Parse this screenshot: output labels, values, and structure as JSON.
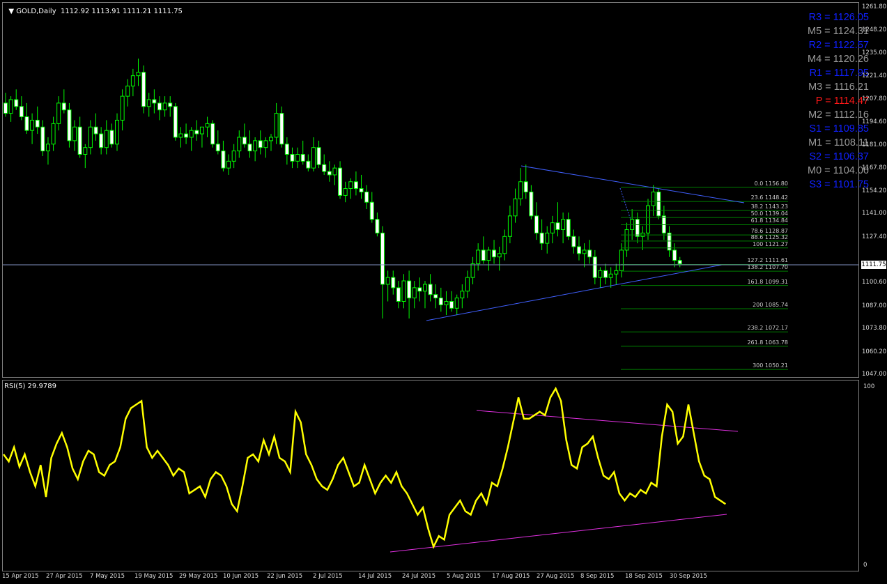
{
  "header": {
    "symbol": "GOLD,Daily",
    "ohlc": "1112.92 1113.91 1111.21 1111.75",
    "rsi_label": "RSI(5) 29.9789"
  },
  "pivots": [
    {
      "name": "R3",
      "value": "1126.05",
      "color": "#1020ff"
    },
    {
      "name": "M5",
      "value": "1124.31",
      "color": "#9a9a9a"
    },
    {
      "name": "R2",
      "value": "1122.57",
      "color": "#1020ff"
    },
    {
      "name": "M4",
      "value": "1120.26",
      "color": "#9a9a9a"
    },
    {
      "name": "R1",
      "value": "1117.95",
      "color": "#1020ff"
    },
    {
      "name": "M3",
      "value": "1116.21",
      "color": "#9a9a9a"
    },
    {
      "name": "P",
      "value": "1114.47",
      "color": "#ff1818"
    },
    {
      "name": "M2",
      "value": "1112.16",
      "color": "#9a9a9a"
    },
    {
      "name": "S1",
      "value": "1109.85",
      "color": "#1020ff"
    },
    {
      "name": "M1",
      "value": "1108.11",
      "color": "#9a9a9a"
    },
    {
      "name": "S2",
      "value": "1106.37",
      "color": "#1020ff"
    },
    {
      "name": "M0",
      "value": "1104.06",
      "color": "#9a9a9a"
    },
    {
      "name": "S3",
      "value": "1101.75",
      "color": "#1020ff"
    }
  ],
  "fibonacci": [
    {
      "label": "0.0 1156.80",
      "price": 1156.8
    },
    {
      "label": "23.6 1148.42",
      "price": 1148.42
    },
    {
      "label": "38.2 1143.23",
      "price": 1143.23
    },
    {
      "label": "50.0 1139.04",
      "price": 1139.04
    },
    {
      "label": "61.8 1134.84",
      "price": 1134.84
    },
    {
      "label": "78.6 1128.87",
      "price": 1128.87
    },
    {
      "label": "88.6 1125.32",
      "price": 1125.32
    },
    {
      "label": "100 1121.27",
      "price": 1121.27
    },
    {
      "label": "127.2 1111.61",
      "price": 1111.61
    },
    {
      "label": "138.2 1107.70",
      "price": 1107.7
    },
    {
      "label": "161.8 1099.31",
      "price": 1099.31
    },
    {
      "label": "200 1085.74",
      "price": 1085.74
    },
    {
      "label": "238.2 1072.17",
      "price": 1072.17
    },
    {
      "label": "261.8 1063.78",
      "price": 1063.78
    },
    {
      "label": "300 1050.21",
      "price": 1050.21
    }
  ],
  "price_axis": {
    "labels": [
      "1261.80",
      "1248.20",
      "1235.00",
      "1221.40",
      "1207.80",
      "1194.60",
      "1181.00",
      "1167.80",
      "1154.20",
      "1141.00",
      "1127.40",
      "1100.60",
      "1087.00",
      "1073.80",
      "1060.20",
      "1047.00"
    ],
    "current_price": "1111.75",
    "colors": {
      "bull": "#00ff00",
      "bear": "#ffffff",
      "trend": "#4060ff",
      "fib": "#008000",
      "price_line": "#8090c0"
    }
  },
  "rsi_axis": {
    "top": "100",
    "bottom": "0"
  },
  "time_axis": [
    "15 Apr 2015",
    "27 Apr 2015",
    "7 May 2015",
    "19 May 2015",
    "29 May 2015",
    "10 Jun 2015",
    "22 Jun 2015",
    "2 Jul 2015",
    "14 Jul 2015",
    "24 Jul 2015",
    "5 Aug 2015",
    "17 Aug 2015",
    "27 Aug 2015",
    "8 Sep 2015",
    "18 Sep 2015",
    "30 Sep 2015"
  ],
  "chart_data": {
    "type": "candlestick",
    "symbol": "GOLD",
    "timeframe": "Daily",
    "ylim": [
      1047,
      1265
    ],
    "candles": [
      [
        1206,
        1212,
        1198,
        1200
      ],
      [
        1200,
        1210,
        1195,
        1208
      ],
      [
        1208,
        1214,
        1202,
        1204
      ],
      [
        1204,
        1210,
        1196,
        1198
      ],
      [
        1198,
        1206,
        1188,
        1190
      ],
      [
        1190,
        1200,
        1182,
        1196
      ],
      [
        1196,
        1204,
        1188,
        1192
      ],
      [
        1192,
        1196,
        1175,
        1178
      ],
      [
        1178,
        1186,
        1170,
        1182
      ],
      [
        1182,
        1198,
        1178,
        1194
      ],
      [
        1194,
        1210,
        1190,
        1206
      ],
      [
        1206,
        1214,
        1200,
        1202
      ],
      [
        1202,
        1206,
        1180,
        1184
      ],
      [
        1184,
        1196,
        1178,
        1192
      ],
      [
        1192,
        1198,
        1174,
        1176
      ],
      [
        1176,
        1182,
        1168,
        1180
      ],
      [
        1180,
        1196,
        1176,
        1192
      ],
      [
        1192,
        1200,
        1184,
        1188
      ],
      [
        1188,
        1192,
        1176,
        1180
      ],
      [
        1180,
        1196,
        1176,
        1190
      ],
      [
        1190,
        1194,
        1180,
        1182
      ],
      [
        1182,
        1200,
        1178,
        1196
      ],
      [
        1196,
        1214,
        1190,
        1210
      ],
      [
        1210,
        1220,
        1204,
        1216
      ],
      [
        1216,
        1226,
        1210,
        1222
      ],
      [
        1222,
        1232,
        1216,
        1224
      ],
      [
        1224,
        1228,
        1200,
        1204
      ],
      [
        1204,
        1212,
        1198,
        1208
      ],
      [
        1208,
        1214,
        1200,
        1206
      ],
      [
        1206,
        1210,
        1196,
        1202
      ],
      [
        1202,
        1210,
        1198,
        1206
      ],
      [
        1206,
        1210,
        1198,
        1204
      ],
      [
        1204,
        1206,
        1184,
        1186
      ],
      [
        1186,
        1192,
        1180,
        1188
      ],
      [
        1188,
        1194,
        1182,
        1186
      ],
      [
        1186,
        1192,
        1178,
        1190
      ],
      [
        1190,
        1196,
        1184,
        1188
      ],
      [
        1188,
        1192,
        1180,
        1192
      ],
      [
        1192,
        1198,
        1186,
        1194
      ],
      [
        1194,
        1196,
        1180,
        1182
      ],
      [
        1182,
        1190,
        1176,
        1178
      ],
      [
        1178,
        1184,
        1166,
        1168
      ],
      [
        1168,
        1176,
        1164,
        1172
      ],
      [
        1172,
        1182,
        1168,
        1178
      ],
      [
        1178,
        1190,
        1174,
        1186
      ],
      [
        1186,
        1194,
        1180,
        1182
      ],
      [
        1182,
        1190,
        1174,
        1178
      ],
      [
        1178,
        1186,
        1172,
        1184
      ],
      [
        1184,
        1190,
        1176,
        1180
      ],
      [
        1180,
        1186,
        1174,
        1184
      ],
      [
        1184,
        1188,
        1178,
        1186
      ],
      [
        1186,
        1206,
        1182,
        1200
      ],
      [
        1200,
        1204,
        1180,
        1182
      ],
      [
        1182,
        1186,
        1170,
        1176
      ],
      [
        1176,
        1180,
        1168,
        1172
      ],
      [
        1172,
        1180,
        1168,
        1176
      ],
      [
        1176,
        1184,
        1170,
        1172
      ],
      [
        1172,
        1176,
        1166,
        1168
      ],
      [
        1168,
        1186,
        1166,
        1180
      ],
      [
        1180,
        1184,
        1168,
        1170
      ],
      [
        1170,
        1176,
        1164,
        1166
      ],
      [
        1166,
        1172,
        1160,
        1164
      ],
      [
        1164,
        1170,
        1158,
        1168
      ],
      [
        1168,
        1172,
        1150,
        1152
      ],
      [
        1152,
        1160,
        1148,
        1156
      ],
      [
        1156,
        1162,
        1150,
        1160
      ],
      [
        1160,
        1166,
        1152,
        1156
      ],
      [
        1156,
        1164,
        1150,
        1154
      ],
      [
        1154,
        1158,
        1144,
        1148
      ],
      [
        1148,
        1154,
        1136,
        1138
      ],
      [
        1138,
        1142,
        1128,
        1130
      ],
      [
        1130,
        1134,
        1080,
        1100
      ],
      [
        1100,
        1108,
        1090,
        1104
      ],
      [
        1104,
        1108,
        1094,
        1098
      ],
      [
        1098,
        1102,
        1086,
        1090
      ],
      [
        1090,
        1106,
        1086,
        1102
      ],
      [
        1102,
        1108,
        1080,
        1092
      ],
      [
        1092,
        1102,
        1086,
        1098
      ],
      [
        1098,
        1104,
        1090,
        1096
      ],
      [
        1096,
        1102,
        1086,
        1100
      ],
      [
        1100,
        1106,
        1090,
        1094
      ],
      [
        1094,
        1100,
        1086,
        1092
      ],
      [
        1092,
        1098,
        1084,
        1088
      ],
      [
        1088,
        1096,
        1082,
        1090
      ],
      [
        1090,
        1096,
        1084,
        1086
      ],
      [
        1086,
        1094,
        1082,
        1092
      ],
      [
        1092,
        1100,
        1086,
        1096
      ],
      [
        1096,
        1108,
        1092,
        1104
      ],
      [
        1104,
        1116,
        1100,
        1112
      ],
      [
        1112,
        1124,
        1108,
        1120
      ],
      [
        1120,
        1128,
        1112,
        1114
      ],
      [
        1114,
        1122,
        1108,
        1120
      ],
      [
        1120,
        1126,
        1112,
        1116
      ],
      [
        1116,
        1122,
        1108,
        1118
      ],
      [
        1118,
        1132,
        1114,
        1128
      ],
      [
        1128,
        1146,
        1124,
        1140
      ],
      [
        1140,
        1156,
        1136,
        1150
      ],
      [
        1150,
        1168,
        1146,
        1160
      ],
      [
        1160,
        1170,
        1150,
        1154
      ],
      [
        1154,
        1158,
        1138,
        1140
      ],
      [
        1140,
        1148,
        1126,
        1130
      ],
      [
        1130,
        1138,
        1120,
        1124
      ],
      [
        1124,
        1134,
        1118,
        1130
      ],
      [
        1130,
        1140,
        1124,
        1136
      ],
      [
        1136,
        1148,
        1128,
        1132
      ],
      [
        1132,
        1142,
        1124,
        1138
      ],
      [
        1138,
        1142,
        1126,
        1128
      ],
      [
        1128,
        1132,
        1118,
        1122
      ],
      [
        1122,
        1128,
        1114,
        1118
      ],
      [
        1118,
        1124,
        1110,
        1120
      ],
      [
        1120,
        1126,
        1112,
        1116
      ],
      [
        1116,
        1120,
        1100,
        1104
      ],
      [
        1104,
        1110,
        1098,
        1108
      ],
      [
        1108,
        1112,
        1100,
        1104
      ],
      [
        1104,
        1110,
        1098,
        1106
      ],
      [
        1106,
        1112,
        1100,
        1108
      ],
      [
        1108,
        1124,
        1104,
        1120
      ],
      [
        1120,
        1136,
        1116,
        1132
      ],
      [
        1132,
        1144,
        1126,
        1138
      ],
      [
        1138,
        1142,
        1124,
        1128
      ],
      [
        1128,
        1134,
        1120,
        1130
      ],
      [
        1130,
        1150,
        1126,
        1146
      ],
      [
        1146,
        1158,
        1140,
        1154
      ],
      [
        1154,
        1156,
        1138,
        1140
      ],
      [
        1140,
        1146,
        1126,
        1130
      ],
      [
        1130,
        1134,
        1116,
        1120
      ],
      [
        1120,
        1124,
        1110,
        1114
      ],
      [
        1114,
        1116,
        1110,
        1112
      ]
    ],
    "rsi": [
      62,
      58,
      66,
      55,
      62,
      52,
      44,
      56,
      38,
      60,
      68,
      74,
      66,
      54,
      48,
      58,
      64,
      62,
      52,
      50,
      56,
      58,
      66,
      82,
      88,
      90,
      92,
      66,
      60,
      64,
      60,
      56,
      50,
      54,
      52,
      40,
      42,
      44,
      38,
      48,
      52,
      50,
      44,
      34,
      30,
      44,
      60,
      62,
      58,
      70,
      62,
      72,
      60,
      58,
      52,
      86,
      80,
      62,
      56,
      48,
      44,
      42,
      48,
      56,
      60,
      52,
      44,
      46,
      56,
      48,
      40,
      46,
      50,
      46,
      52,
      44,
      40,
      34,
      28,
      32,
      20,
      10,
      16,
      14,
      28,
      32,
      36,
      30,
      28,
      36,
      40,
      34,
      46,
      44,
      54,
      66,
      80,
      94,
      82,
      82,
      84,
      86,
      84,
      94,
      99,
      92,
      70,
      56,
      54,
      66,
      68,
      72,
      60,
      50,
      48,
      52,
      40,
      36,
      40,
      38,
      42,
      40,
      46,
      44,
      72,
      90,
      86,
      68,
      72,
      90,
      74,
      58,
      50,
      48,
      38,
      36,
      34
    ],
    "rsi_ylim": [
      0,
      100
    ],
    "x_tick_labels": [
      "15 Apr 2015",
      "27 Apr 2015",
      "7 May 2015",
      "19 May 2015",
      "29 May 2015",
      "10 Jun 2015",
      "22 Jun 2015",
      "2 Jul 2015",
      "14 Jul 2015",
      "24 Jul 2015",
      "5 Aug 2015",
      "17 Aug 2015",
      "27 Aug 2015",
      "8 Sep 2015",
      "18 Sep 2015",
      "30 Sep 2015"
    ],
    "grid": false
  }
}
